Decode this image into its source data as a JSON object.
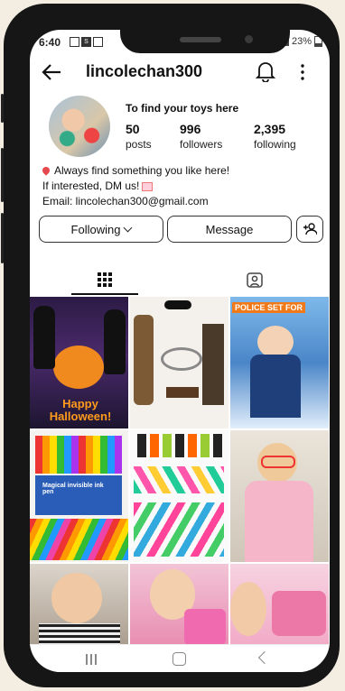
{
  "status": {
    "time": "6:40",
    "battery": "23%"
  },
  "header": {
    "username": "lincolechan300"
  },
  "profile": {
    "bio_title": "To find your toys here",
    "stats": [
      {
        "value": "50",
        "label": "posts"
      },
      {
        "value": "996",
        "label": "followers"
      },
      {
        "value": "2,395",
        "label": "following"
      }
    ],
    "bio_lines": [
      "Always find something you like here!",
      "If interested, DM us!",
      "Email: lincolechan300@gmail.com"
    ]
  },
  "actions": {
    "following_label": "Following",
    "message_label": "Message"
  },
  "posts": {
    "captions": [
      "Happy Halloween!",
      "POLICE SET FOR",
      "Magical invisible ink pen"
    ]
  },
  "colors": {
    "accent": "#111111",
    "badge": "#e5484d",
    "screen_bg": "#ffffff"
  }
}
